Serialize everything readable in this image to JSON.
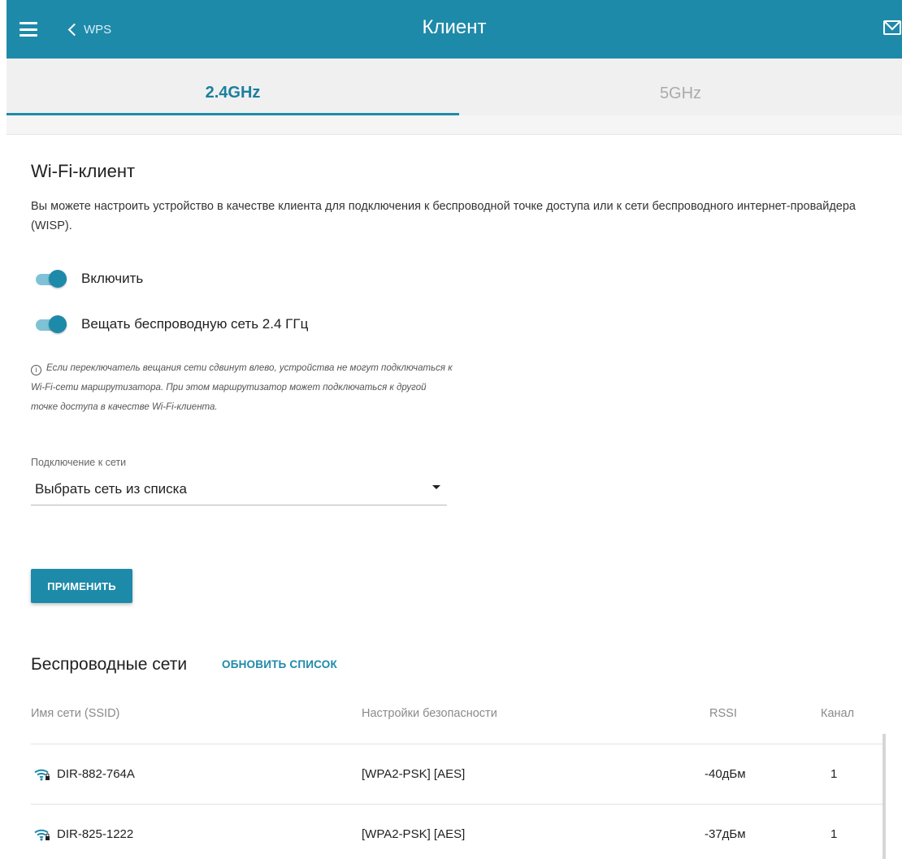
{
  "header": {
    "back_label": "WPS",
    "title": "Клиент"
  },
  "tabs": [
    {
      "label": "2.4GHz",
      "active": true
    },
    {
      "label": "5GHz",
      "active": false
    }
  ],
  "section": {
    "title": "Wi-Fi-клиент",
    "description": "Вы можете настроить устройство в качестве клиента для подключения к беспроводной точке доступа или к сети беспроводного интернет-провайдера (WISP)."
  },
  "toggles": [
    {
      "label": "Включить",
      "on": true
    },
    {
      "label": "Вещать беспроводную сеть 2.4 ГГц",
      "on": true
    }
  ],
  "info": {
    "icon_glyph": "i",
    "text": "Если переключатель вещания сети сдвинут влево, устройства не могут подключаться к Wi-Fi-сети маршрутизатора. При этом маршрутизатор может подключаться к другой точке доступа в качестве Wi-Fi-клиента."
  },
  "connection": {
    "label": "Подключение к сети",
    "value": "Выбрать сеть из списка"
  },
  "apply_label": "ПРИМЕНИТЬ",
  "networks": {
    "title": "Беспроводные сети",
    "refresh_label": "ОБНОВИТЬ СПИСОК",
    "columns": [
      "Имя сети (SSID)",
      "Настройки безопасности",
      "RSSI",
      "Канал"
    ],
    "rows": [
      {
        "ssid": "DIR-882-764A",
        "security": "[WPA2-PSK] [AES]",
        "rssi": "-40дБм",
        "channel": "1"
      },
      {
        "ssid": "DIR-825-1222",
        "security": "[WPA2-PSK] [AES]",
        "rssi": "-37дБм",
        "channel": "1"
      }
    ]
  },
  "colors": {
    "accent": "#1e8aa9",
    "toggle_track": "#7fc2d6"
  },
  "icons": [
    "menu-icon",
    "chevron-left-icon",
    "mail-icon",
    "info-icon",
    "wifi-locked-icon",
    "dropdown-caret-icon"
  ]
}
